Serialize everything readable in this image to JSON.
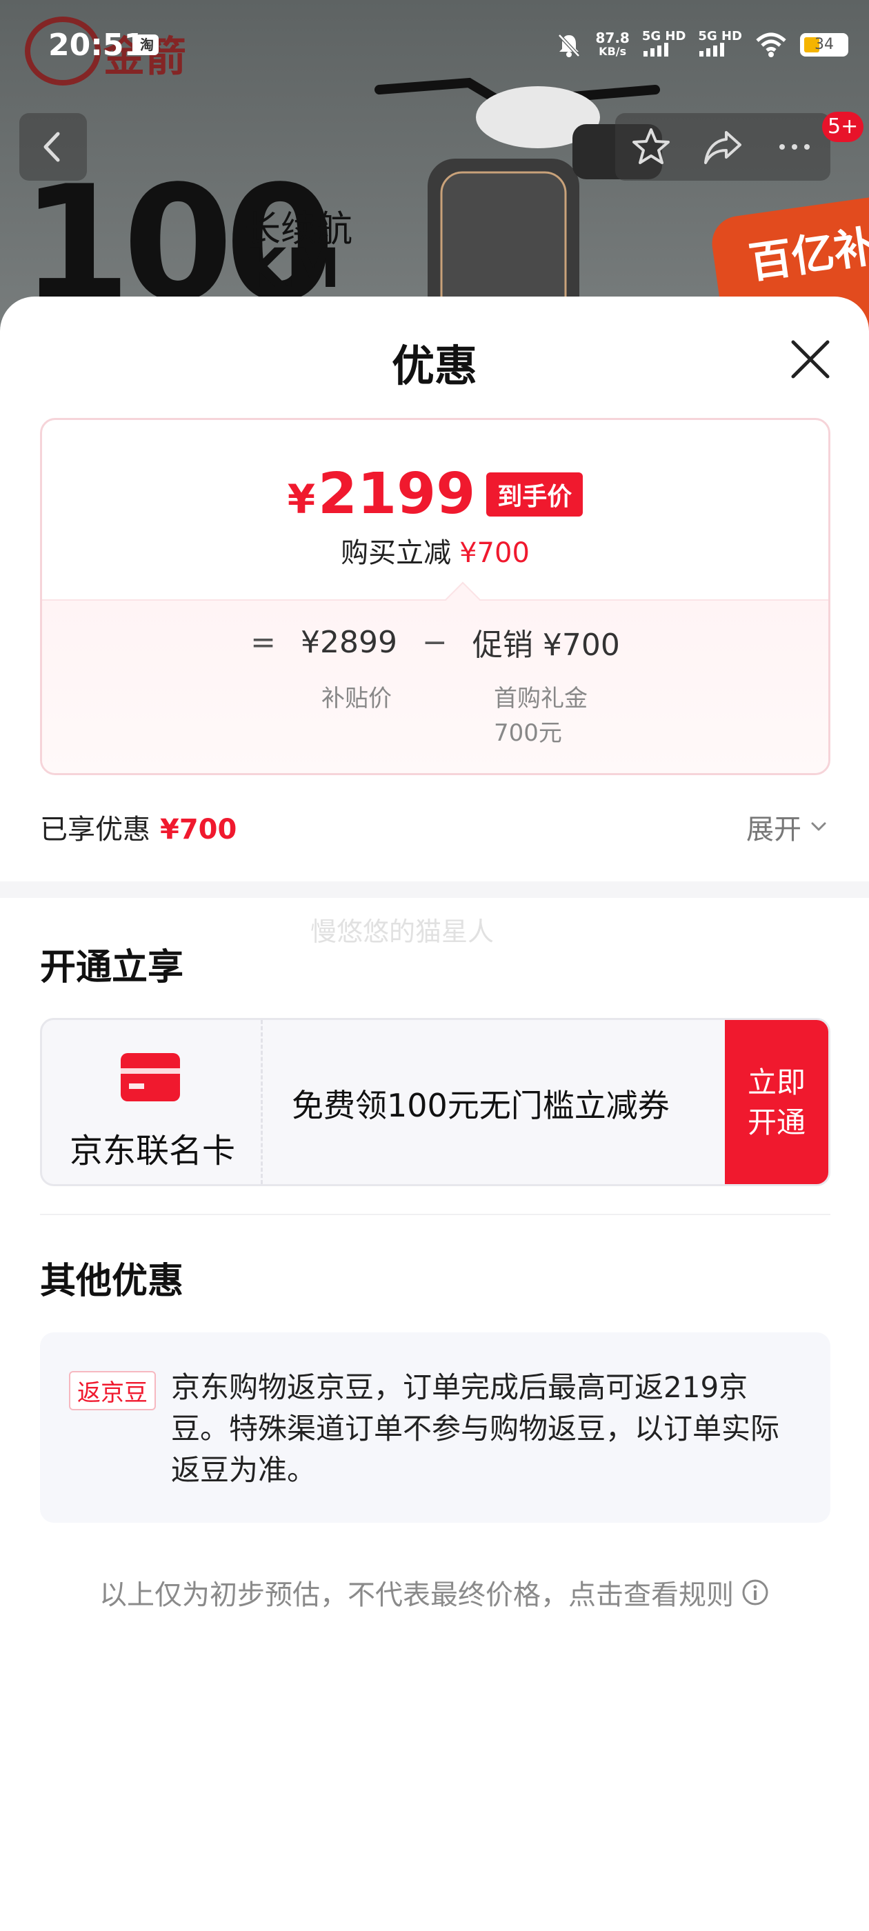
{
  "status_bar": {
    "time": "20:51",
    "app_icon_label": "淘",
    "net_speed_value": "87.8",
    "net_speed_unit": "KB/s",
    "signal1": "5G HD",
    "signal2": "5G HD",
    "battery": "34"
  },
  "background": {
    "logo_text": "金箭",
    "headline_number": "100",
    "headline_unit": "KM",
    "headline_sub": "长续航",
    "badge_text": "百亿补贴"
  },
  "nav": {
    "badge": "5+"
  },
  "sheet": {
    "title": "优惠",
    "final_price_currency": "¥",
    "final_price": "2199",
    "final_price_tag": "到手价",
    "reduce_label": "购买立减",
    "reduce_amount": "¥700",
    "formula": {
      "eq": "=",
      "subsidy_price": "¥2899",
      "minus": "−",
      "promo": "促销 ¥700",
      "subsidy_label": "补贴价",
      "promo_label": "首购礼金",
      "promo_sub": "700元"
    },
    "enjoyed_label": "已享优惠",
    "enjoyed_amount": "¥700",
    "expand_label": "展开",
    "watermark": "慢悠悠的猫星人",
    "open_section_title": "开通立享",
    "card": {
      "name": "京东联名卡",
      "text": "免费领100元无门槛立减券",
      "cta_line1": "立即",
      "cta_line2": "开通"
    },
    "other_section_title": "其他优惠",
    "bean": {
      "tag": "返京豆",
      "text": "京东购物返京豆，订单完成后最高可返219京豆。特殊渠道订单不参与购物返豆，以订单实际返豆为准。"
    },
    "rules_text": "以上仅为初步预估，不代表最终价格，点击查看规则"
  },
  "colors": {
    "accent": "#f0192e"
  }
}
